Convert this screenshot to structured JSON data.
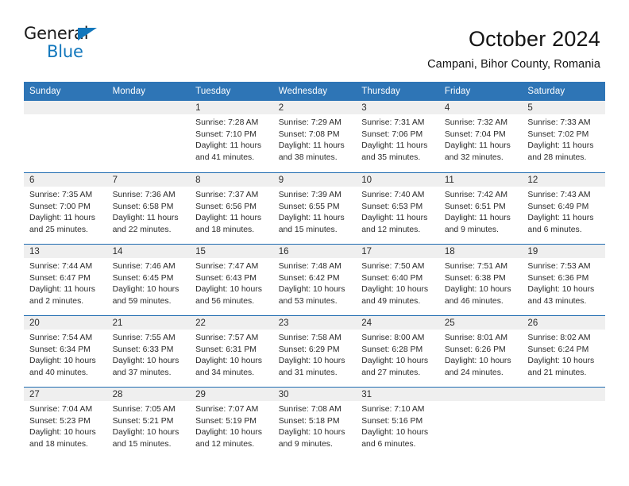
{
  "brand": {
    "name_part1": "General",
    "name_part2": "Blue",
    "triangle_color": "#1277bc"
  },
  "header": {
    "title": "October 2024",
    "subtitle": "Campani, Bihor County, Romania"
  },
  "theme": {
    "header_blue": "#2e75b6",
    "separator_blue": "#1f6bb0",
    "day_band_gray": "#efefef",
    "text_color": "#2b2b2b"
  },
  "weekdays": [
    "Sunday",
    "Monday",
    "Tuesday",
    "Wednesday",
    "Thursday",
    "Friday",
    "Saturday"
  ],
  "weeks": [
    [
      {
        "day": "",
        "empty": true,
        "lines": []
      },
      {
        "day": "",
        "empty": true,
        "lines": []
      },
      {
        "day": "1",
        "empty": false,
        "lines": [
          "Sunrise: 7:28 AM",
          "Sunset: 7:10 PM",
          "Daylight: 11 hours",
          "and 41 minutes."
        ]
      },
      {
        "day": "2",
        "empty": false,
        "lines": [
          "Sunrise: 7:29 AM",
          "Sunset: 7:08 PM",
          "Daylight: 11 hours",
          "and 38 minutes."
        ]
      },
      {
        "day": "3",
        "empty": false,
        "lines": [
          "Sunrise: 7:31 AM",
          "Sunset: 7:06 PM",
          "Daylight: 11 hours",
          "and 35 minutes."
        ]
      },
      {
        "day": "4",
        "empty": false,
        "lines": [
          "Sunrise: 7:32 AM",
          "Sunset: 7:04 PM",
          "Daylight: 11 hours",
          "and 32 minutes."
        ]
      },
      {
        "day": "5",
        "empty": false,
        "lines": [
          "Sunrise: 7:33 AM",
          "Sunset: 7:02 PM",
          "Daylight: 11 hours",
          "and 28 minutes."
        ]
      }
    ],
    [
      {
        "day": "6",
        "empty": false,
        "lines": [
          "Sunrise: 7:35 AM",
          "Sunset: 7:00 PM",
          "Daylight: 11 hours",
          "and 25 minutes."
        ]
      },
      {
        "day": "7",
        "empty": false,
        "lines": [
          "Sunrise: 7:36 AM",
          "Sunset: 6:58 PM",
          "Daylight: 11 hours",
          "and 22 minutes."
        ]
      },
      {
        "day": "8",
        "empty": false,
        "lines": [
          "Sunrise: 7:37 AM",
          "Sunset: 6:56 PM",
          "Daylight: 11 hours",
          "and 18 minutes."
        ]
      },
      {
        "day": "9",
        "empty": false,
        "lines": [
          "Sunrise: 7:39 AM",
          "Sunset: 6:55 PM",
          "Daylight: 11 hours",
          "and 15 minutes."
        ]
      },
      {
        "day": "10",
        "empty": false,
        "lines": [
          "Sunrise: 7:40 AM",
          "Sunset: 6:53 PM",
          "Daylight: 11 hours",
          "and 12 minutes."
        ]
      },
      {
        "day": "11",
        "empty": false,
        "lines": [
          "Sunrise: 7:42 AM",
          "Sunset: 6:51 PM",
          "Daylight: 11 hours",
          "and 9 minutes."
        ]
      },
      {
        "day": "12",
        "empty": false,
        "lines": [
          "Sunrise: 7:43 AM",
          "Sunset: 6:49 PM",
          "Daylight: 11 hours",
          "and 6 minutes."
        ]
      }
    ],
    [
      {
        "day": "13",
        "empty": false,
        "lines": [
          "Sunrise: 7:44 AM",
          "Sunset: 6:47 PM",
          "Daylight: 11 hours",
          "and 2 minutes."
        ]
      },
      {
        "day": "14",
        "empty": false,
        "lines": [
          "Sunrise: 7:46 AM",
          "Sunset: 6:45 PM",
          "Daylight: 10 hours",
          "and 59 minutes."
        ]
      },
      {
        "day": "15",
        "empty": false,
        "lines": [
          "Sunrise: 7:47 AM",
          "Sunset: 6:43 PM",
          "Daylight: 10 hours",
          "and 56 minutes."
        ]
      },
      {
        "day": "16",
        "empty": false,
        "lines": [
          "Sunrise: 7:48 AM",
          "Sunset: 6:42 PM",
          "Daylight: 10 hours",
          "and 53 minutes."
        ]
      },
      {
        "day": "17",
        "empty": false,
        "lines": [
          "Sunrise: 7:50 AM",
          "Sunset: 6:40 PM",
          "Daylight: 10 hours",
          "and 49 minutes."
        ]
      },
      {
        "day": "18",
        "empty": false,
        "lines": [
          "Sunrise: 7:51 AM",
          "Sunset: 6:38 PM",
          "Daylight: 10 hours",
          "and 46 minutes."
        ]
      },
      {
        "day": "19",
        "empty": false,
        "lines": [
          "Sunrise: 7:53 AM",
          "Sunset: 6:36 PM",
          "Daylight: 10 hours",
          "and 43 minutes."
        ]
      }
    ],
    [
      {
        "day": "20",
        "empty": false,
        "lines": [
          "Sunrise: 7:54 AM",
          "Sunset: 6:34 PM",
          "Daylight: 10 hours",
          "and 40 minutes."
        ]
      },
      {
        "day": "21",
        "empty": false,
        "lines": [
          "Sunrise: 7:55 AM",
          "Sunset: 6:33 PM",
          "Daylight: 10 hours",
          "and 37 minutes."
        ]
      },
      {
        "day": "22",
        "empty": false,
        "lines": [
          "Sunrise: 7:57 AM",
          "Sunset: 6:31 PM",
          "Daylight: 10 hours",
          "and 34 minutes."
        ]
      },
      {
        "day": "23",
        "empty": false,
        "lines": [
          "Sunrise: 7:58 AM",
          "Sunset: 6:29 PM",
          "Daylight: 10 hours",
          "and 31 minutes."
        ]
      },
      {
        "day": "24",
        "empty": false,
        "lines": [
          "Sunrise: 8:00 AM",
          "Sunset: 6:28 PM",
          "Daylight: 10 hours",
          "and 27 minutes."
        ]
      },
      {
        "day": "25",
        "empty": false,
        "lines": [
          "Sunrise: 8:01 AM",
          "Sunset: 6:26 PM",
          "Daylight: 10 hours",
          "and 24 minutes."
        ]
      },
      {
        "day": "26",
        "empty": false,
        "lines": [
          "Sunrise: 8:02 AM",
          "Sunset: 6:24 PM",
          "Daylight: 10 hours",
          "and 21 minutes."
        ]
      }
    ],
    [
      {
        "day": "27",
        "empty": false,
        "lines": [
          "Sunrise: 7:04 AM",
          "Sunset: 5:23 PM",
          "Daylight: 10 hours",
          "and 18 minutes."
        ]
      },
      {
        "day": "28",
        "empty": false,
        "lines": [
          "Sunrise: 7:05 AM",
          "Sunset: 5:21 PM",
          "Daylight: 10 hours",
          "and 15 minutes."
        ]
      },
      {
        "day": "29",
        "empty": false,
        "lines": [
          "Sunrise: 7:07 AM",
          "Sunset: 5:19 PM",
          "Daylight: 10 hours",
          "and 12 minutes."
        ]
      },
      {
        "day": "30",
        "empty": false,
        "lines": [
          "Sunrise: 7:08 AM",
          "Sunset: 5:18 PM",
          "Daylight: 10 hours",
          "and 9 minutes."
        ]
      },
      {
        "day": "31",
        "empty": false,
        "lines": [
          "Sunrise: 7:10 AM",
          "Sunset: 5:16 PM",
          "Daylight: 10 hours",
          "and 6 minutes."
        ]
      },
      {
        "day": "",
        "empty": true,
        "lines": []
      },
      {
        "day": "",
        "empty": true,
        "lines": []
      }
    ]
  ]
}
